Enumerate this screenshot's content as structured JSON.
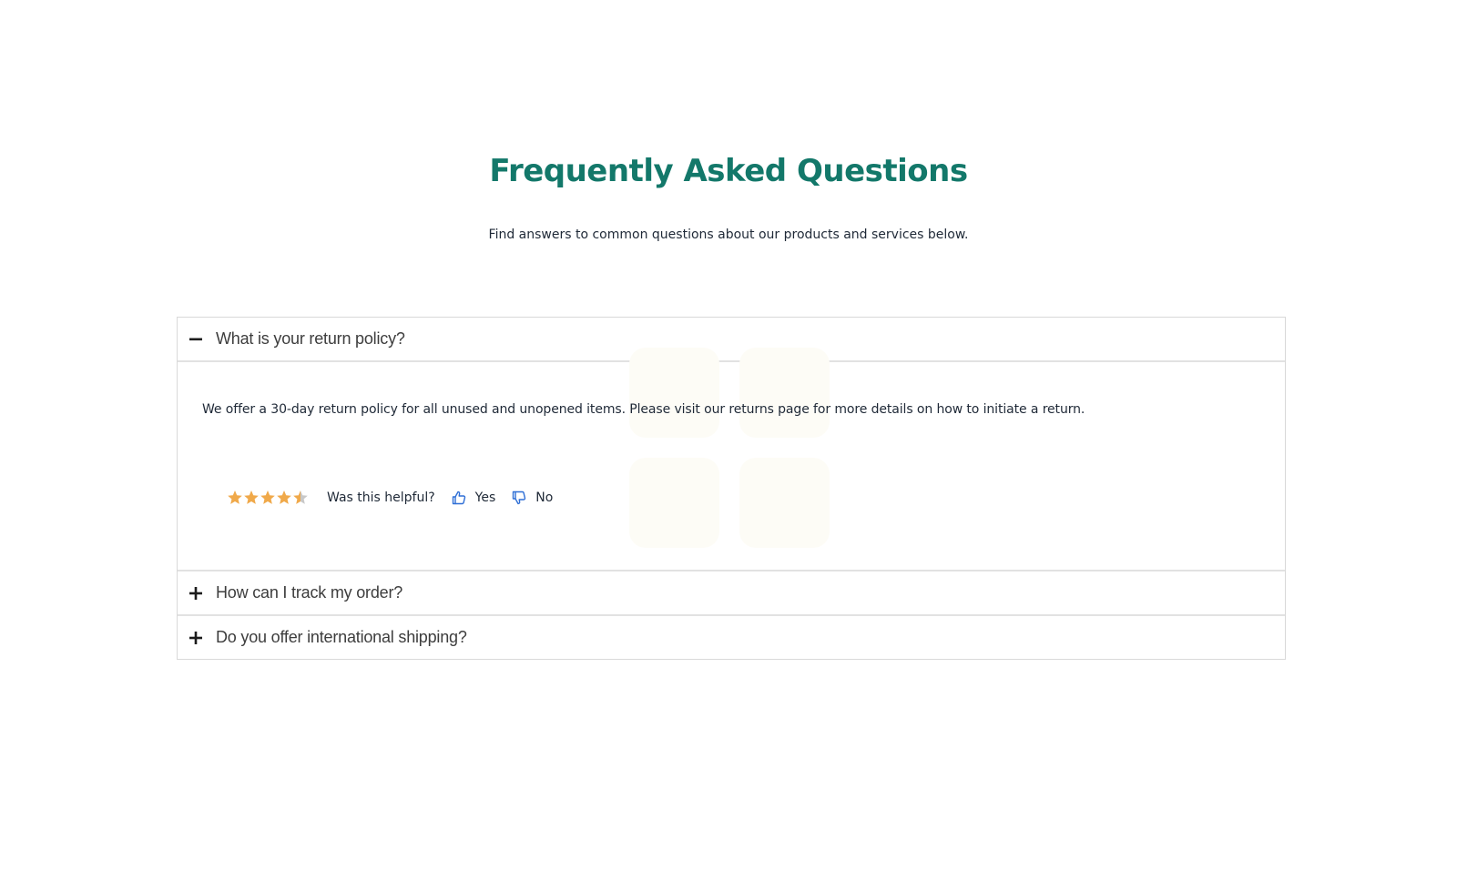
{
  "header": {
    "title": "Frequently Asked Questions",
    "subtitle": "Find answers to common questions about our products and services below."
  },
  "colors": {
    "title": "#13786a",
    "star": "#f0a94a",
    "star_empty": "#c8c8c8",
    "vote_icon": "#2f6fd6"
  },
  "faq": {
    "items": [
      {
        "question": "What is your return policy?",
        "expanded": true,
        "toggle_icon": "minus-icon",
        "answer": "We offer a 30-day return policy for all unused and unopened items. Please visit our returns page for more details on how to initiate a return.",
        "rating": {
          "value": 4.5,
          "max": 5
        },
        "feedback": {
          "prompt": "Was this helpful?",
          "yes_label": "Yes",
          "yes_icon": "thumbs-up-icon",
          "no_label": "No",
          "no_icon": "thumbs-down-icon"
        }
      },
      {
        "question": "How can I track my order?",
        "expanded": false,
        "toggle_icon": "plus-icon"
      },
      {
        "question": "Do you offer international shipping?",
        "expanded": false,
        "toggle_icon": "plus-icon"
      }
    ]
  }
}
